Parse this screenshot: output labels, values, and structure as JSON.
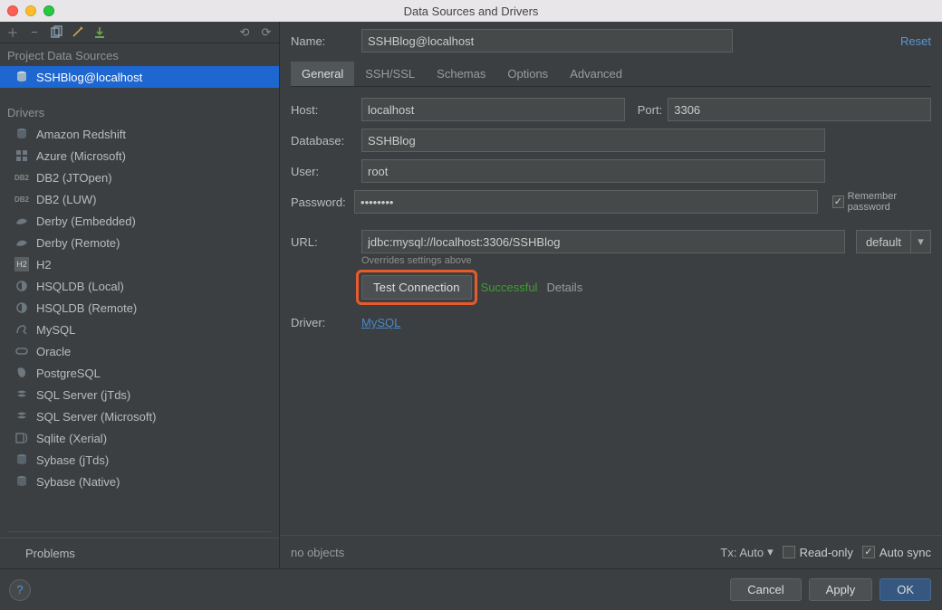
{
  "window": {
    "title": "Data Sources and Drivers"
  },
  "sidebar": {
    "project_header": "Project Data Sources",
    "data_sources": [
      {
        "label": "SSHBlog@localhost",
        "selected": true
      }
    ],
    "drivers_header": "Drivers",
    "drivers": [
      "Amazon Redshift",
      "Azure (Microsoft)",
      "DB2 (JTOpen)",
      "DB2 (LUW)",
      "Derby (Embedded)",
      "Derby (Remote)",
      "H2",
      "HSQLDB (Local)",
      "HSQLDB (Remote)",
      "MySQL",
      "Oracle",
      "PostgreSQL",
      "SQL Server (jTds)",
      "SQL Server (Microsoft)",
      "Sqlite (Xerial)",
      "Sybase (jTds)",
      "Sybase (Native)"
    ],
    "problems": "Problems"
  },
  "form": {
    "name_label": "Name:",
    "name_value": "SSHBlog@localhost",
    "reset": "Reset",
    "tabs": [
      "General",
      "SSH/SSL",
      "Schemas",
      "Options",
      "Advanced"
    ],
    "active_tab": 0,
    "host_label": "Host:",
    "host_value": "localhost",
    "port_label": "Port:",
    "port_value": "3306",
    "database_label": "Database:",
    "database_value": "SSHBlog",
    "user_label": "User:",
    "user_value": "root",
    "password_label": "Password:",
    "password_value": "••••••••",
    "remember": "Remember password",
    "url_label": "URL:",
    "url_value": "jdbc:mysql://localhost:3306/SSHBlog",
    "url_dropdown": "default",
    "override": "Overrides settings above",
    "test_label": "Test Connection",
    "success": "Successful",
    "details": "Details",
    "driver_label": "Driver:",
    "driver_value": "MySQL"
  },
  "status": {
    "no_objects": "no objects",
    "tx": "Tx: Auto",
    "read_only": "Read-only",
    "auto_sync": "Auto sync"
  },
  "buttons": {
    "cancel": "Cancel",
    "apply": "Apply",
    "ok": "OK"
  }
}
